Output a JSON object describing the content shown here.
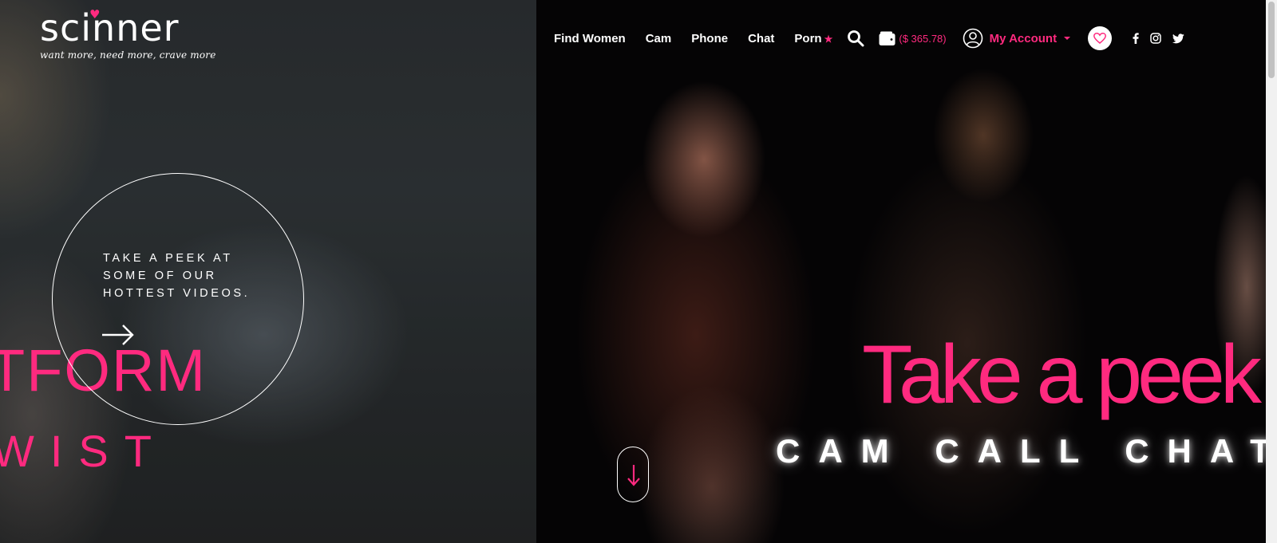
{
  "logo": {
    "word": "scinner",
    "tagline": "want more, need more, crave more"
  },
  "intro": {
    "peek_text": "TAKE A PEEK AT SOME OF OUR HOTTEST VIDEOS.",
    "bg_word_1": "TFORM",
    "bg_word_2": "WIST"
  },
  "nav": {
    "items": [
      {
        "label": "Find Women"
      },
      {
        "label": "Cam"
      },
      {
        "label": "Phone"
      },
      {
        "label": "Chat"
      },
      {
        "label": "Porn"
      }
    ],
    "wallet_amount": "($ 365.78)",
    "account_label": "My Account"
  },
  "hero": {
    "script": "Take a peek",
    "subtitle": "CAM CALL CHAT"
  },
  "icons": {
    "search": "search-icon",
    "wallet": "wallet-icon",
    "account": "user-circle-icon",
    "favorites": "heart-icon",
    "facebook": "facebook-icon",
    "instagram": "instagram-icon",
    "twitter": "twitter-icon",
    "scroll": "arrow-down-icon"
  },
  "colors": {
    "accent": "#ff2a7f",
    "background": "#000000",
    "text": "#ffffff"
  }
}
